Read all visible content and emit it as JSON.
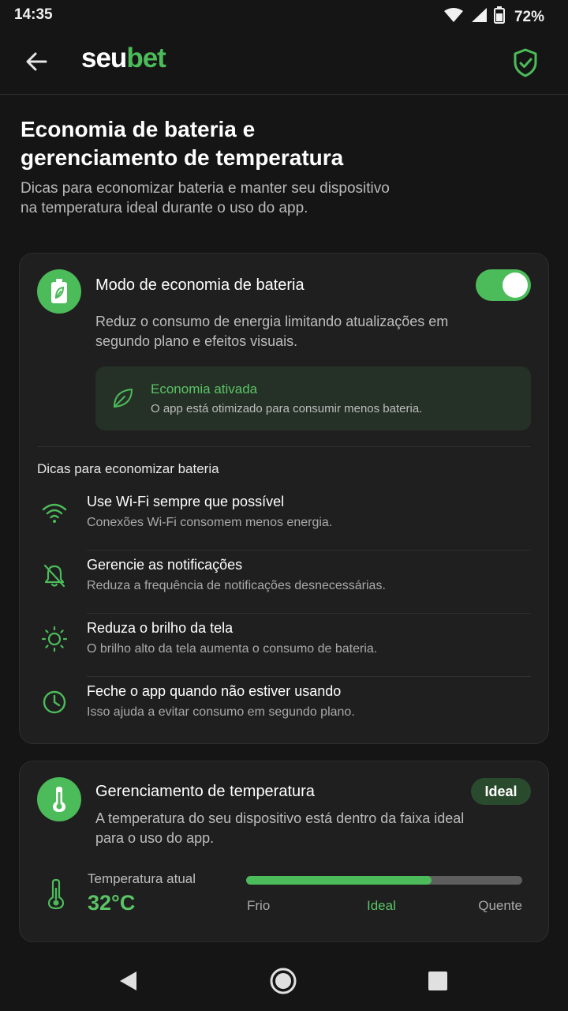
{
  "status_bar": {
    "time": "14:35",
    "battery_percent": "72%",
    "icons": [
      "wifi-icon",
      "signal-icon",
      "battery-icon"
    ]
  },
  "app_bar": {
    "logo_part1": "seu",
    "logo_part2": "bet",
    "back_icon": "arrow-left-icon",
    "right_icon": "shield-check-icon"
  },
  "page": {
    "title": "Economia de bateria e gerenciamento de temperatura",
    "subtitle": "Dicas para economizar bateria e manter seu dispositivo na temperatura ideal durante o uso do app."
  },
  "battery_card": {
    "icon": "battery-leaf-icon",
    "title": "Modo de economia de bateria",
    "toggle_on": true,
    "description": "Reduz o consumo de energia limitando atualizações em segundo plano e efeitos visuais.",
    "status_icon": "leaf-icon",
    "status_title": "Economia ativada",
    "status_text": "O app está otimizado para consumir menos bateria.",
    "tips_heading": "Dicas para economizar bateria",
    "tips": [
      {
        "icon": "wifi-icon",
        "title": "Use Wi-Fi sempre que possível",
        "text": "Conexões Wi-Fi consomem menos energia."
      },
      {
        "icon": "bell-off-icon",
        "title": "Gerencie as notificações",
        "text": "Reduza a frequência de notificações desnecessárias."
      },
      {
        "icon": "sun-icon",
        "title": "Reduza o brilho da tela",
        "text": "O brilho alto da tela aumenta o consumo de bateria."
      },
      {
        "icon": "clock-icon",
        "title": "Feche o app quando não estiver usando",
        "text": "Isso ajuda a evitar consumo em segundo plano."
      }
    ]
  },
  "temp_card": {
    "icon": "thermometer-icon",
    "title": "Gerenciamento de temperatura",
    "badge": "Ideal",
    "description": "A temperatura do seu dispositivo está dentro da faixa ideal para o uso do app.",
    "current_label": "Temperatura atual",
    "current_value": "32°C",
    "level_fraction": 0.67,
    "scale_low": "Frio",
    "scale_mid": "Ideal",
    "scale_high": "Quente"
  },
  "colors": {
    "accent": "#4cbb5a",
    "background": "#151515",
    "card": "#1f1f1f"
  },
  "nav_bar": {
    "icons": [
      "back-triangle-icon",
      "home-circle-icon",
      "recents-square-icon"
    ]
  }
}
